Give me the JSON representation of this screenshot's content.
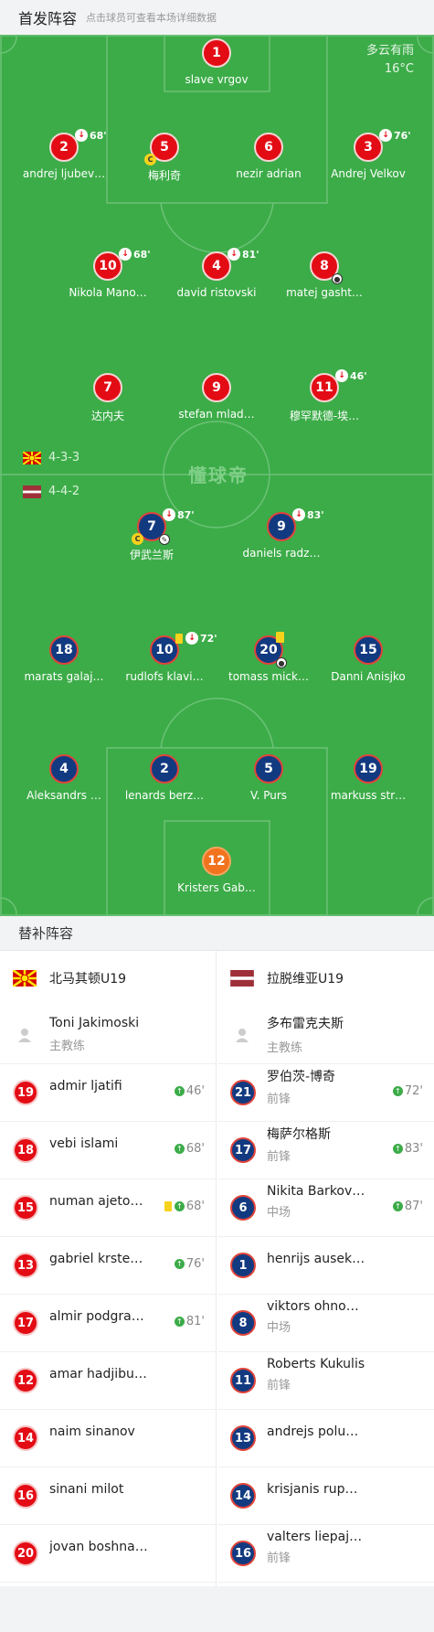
{
  "header": {
    "title": "首发阵容",
    "subtitle": "点击球员可查看本场详细数据"
  },
  "weather": {
    "condition": "多云有雨",
    "temp": "16°C"
  },
  "watermark": "懂球帝",
  "home": {
    "formation": "4-3-3",
    "players": [
      {
        "num": "1",
        "name": "slave vrgov"
      },
      {
        "num": "2",
        "name": "andrej ljubev…",
        "sub": "68'"
      },
      {
        "num": "5",
        "name": "梅利奇",
        "captain": "C"
      },
      {
        "num": "6",
        "name": "nezir adrian"
      },
      {
        "num": "3",
        "name": "Andrej Velkov",
        "sub": "76'"
      },
      {
        "num": "10",
        "name": "Nikola Mano…",
        "sub": "68'"
      },
      {
        "num": "4",
        "name": "david ristovski",
        "sub": "81'"
      },
      {
        "num": "8",
        "name": "matej gasht…"
      },
      {
        "num": "7",
        "name": "达内夫"
      },
      {
        "num": "9",
        "name": "stefan mlad…"
      },
      {
        "num": "11",
        "name": "穆罕默德-埃…",
        "sub": "46'"
      }
    ]
  },
  "away": {
    "formation": "4-4-2",
    "players": [
      {
        "num": "7",
        "name": "伊武兰斯",
        "sub": "87'",
        "captain": "C"
      },
      {
        "num": "9",
        "name": "daniels radz…",
        "sub": "83'"
      },
      {
        "num": "18",
        "name": "marats galaj…"
      },
      {
        "num": "10",
        "name": "rudlofs klavi…",
        "sub": "72'"
      },
      {
        "num": "20",
        "name": "tomass mick…"
      },
      {
        "num": "15",
        "name": "Danni Anisjko"
      },
      {
        "num": "4",
        "name": "Aleksandrs …"
      },
      {
        "num": "2",
        "name": "lenards berz…"
      },
      {
        "num": "5",
        "name": "V. Purs"
      },
      {
        "num": "19",
        "name": "markuss str…"
      },
      {
        "num": "12",
        "name": "Kristers Gab…"
      }
    ]
  },
  "bench": {
    "title": "替补阵容",
    "home": {
      "team": "北马其顿U19",
      "coach": {
        "name": "Toni Jakimoski",
        "role": "主教练"
      },
      "subs": [
        {
          "num": "19",
          "name": "admir ljatifi",
          "pos": "",
          "in": "46'"
        },
        {
          "num": "18",
          "name": "vebi islami",
          "pos": "",
          "in": "68'"
        },
        {
          "num": "15",
          "name": "numan ajetovikj",
          "pos": "",
          "in": "68'"
        },
        {
          "num": "13",
          "name": "gabriel krstev…",
          "pos": "",
          "in": "76'"
        },
        {
          "num": "17",
          "name": "almir podgragja",
          "pos": "",
          "in": "81'"
        },
        {
          "num": "12",
          "name": "amar hadjibulikj",
          "pos": "",
          "in": ""
        },
        {
          "num": "14",
          "name": "naim sinanov",
          "pos": "",
          "in": ""
        },
        {
          "num": "16",
          "name": "sinani milot",
          "pos": "",
          "in": ""
        },
        {
          "num": "20",
          "name": "jovan boshna…",
          "pos": "",
          "in": ""
        }
      ]
    },
    "away": {
      "team": "拉脱维亚U19",
      "coach": {
        "name": "多布雷克夫斯",
        "role": "主教练"
      },
      "subs": [
        {
          "num": "21",
          "name": "罗伯茨-博奇",
          "pos": "前锋",
          "in": "72'"
        },
        {
          "num": "17",
          "name": "梅萨尔格斯",
          "pos": "前锋",
          "in": "83'"
        },
        {
          "num": "6",
          "name": "Nikita Barkov…",
          "pos": "中场",
          "in": "87'"
        },
        {
          "num": "1",
          "name": "henrijs auseklis",
          "pos": "",
          "in": ""
        },
        {
          "num": "8",
          "name": "viktors ohnov…",
          "pos": "中场",
          "in": ""
        },
        {
          "num": "11",
          "name": "Roberts Kukulis",
          "pos": "前锋",
          "in": ""
        },
        {
          "num": "13",
          "name": "andrejs poluh…",
          "pos": "",
          "in": ""
        },
        {
          "num": "14",
          "name": "krisjanis rupeiks",
          "pos": "",
          "in": ""
        },
        {
          "num": "16",
          "name": "valters liepajn…",
          "pos": "前锋",
          "in": ""
        }
      ]
    }
  },
  "colors": {
    "pitch": "#3cac48",
    "home": "#e30c15",
    "away": "#123a80",
    "keeper": "#f2731e"
  }
}
